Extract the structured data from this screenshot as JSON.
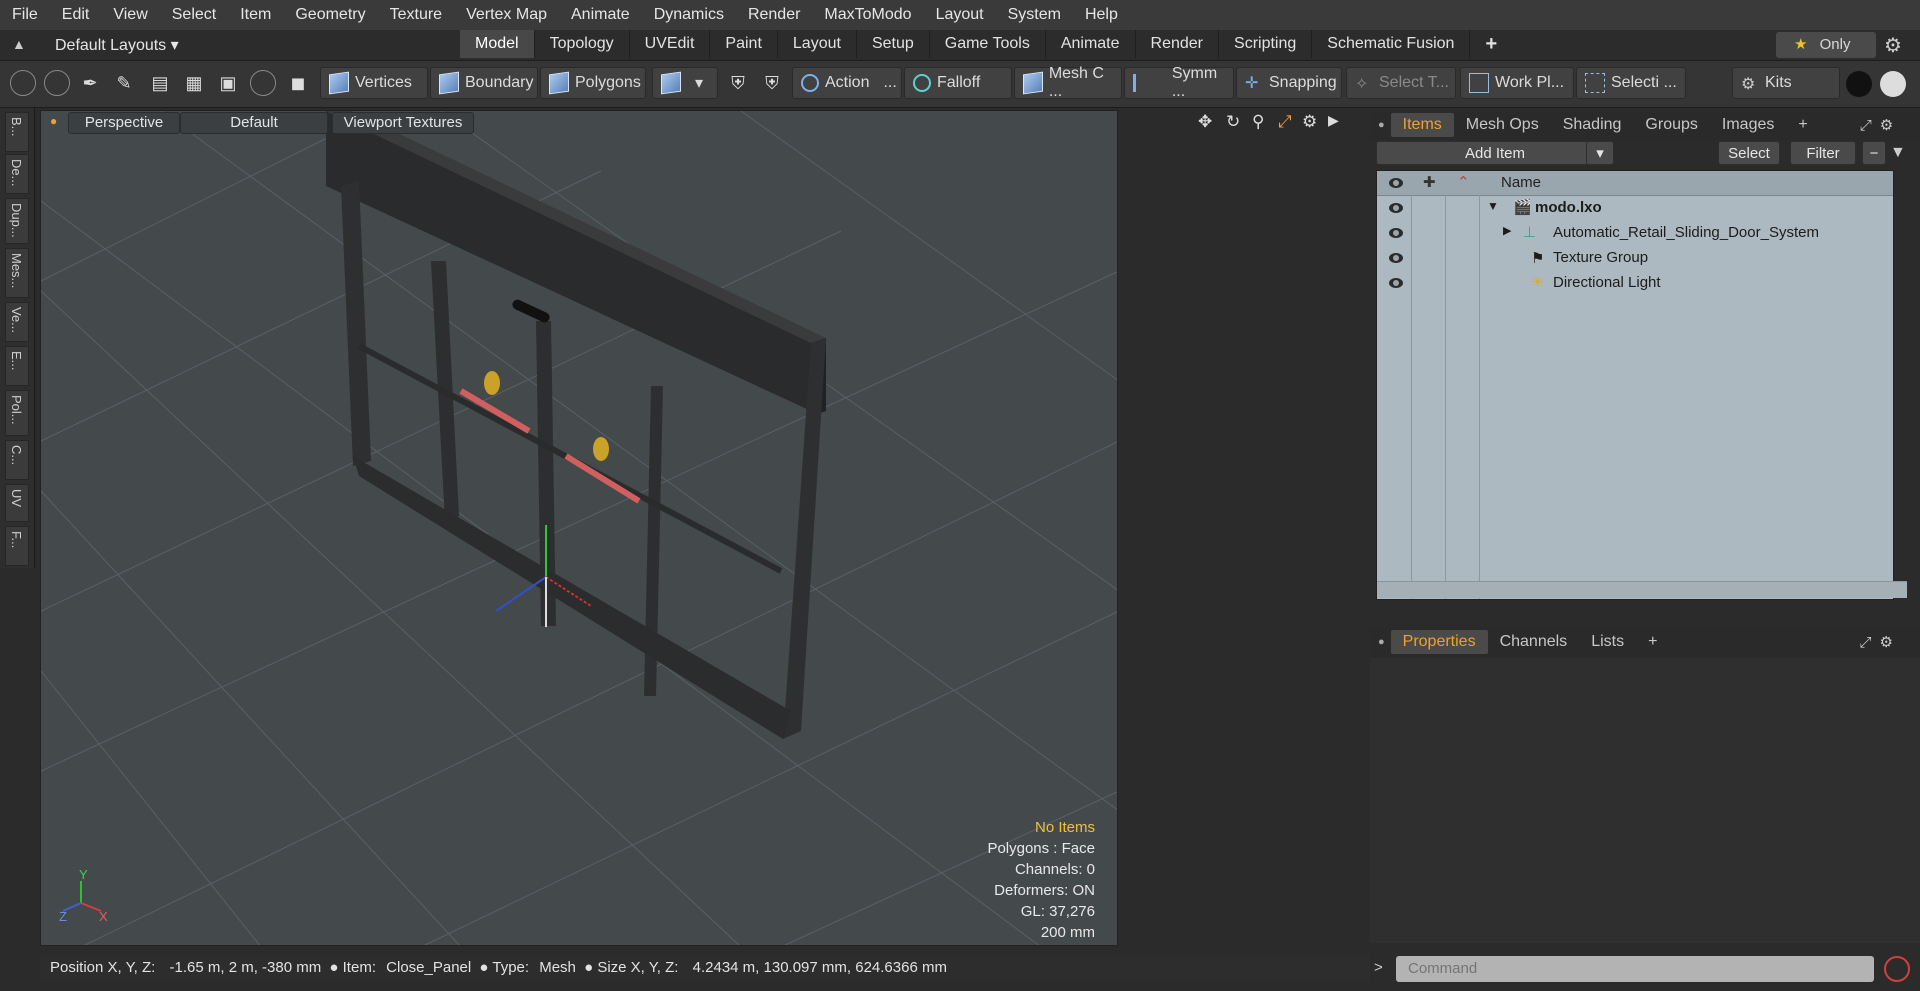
{
  "menu": [
    "File",
    "Edit",
    "View",
    "Select",
    "Item",
    "Geometry",
    "Texture",
    "Vertex Map",
    "Animate",
    "Dynamics",
    "Render",
    "MaxToModo",
    "Layout",
    "System",
    "Help"
  ],
  "layout": {
    "default_layouts": "Default Layouts",
    "tabs": [
      "Model",
      "Topology",
      "UVEdit",
      "Paint",
      "Layout",
      "Setup",
      "Game Tools",
      "Animate",
      "Render",
      "Scripting",
      "Schematic Fusion"
    ],
    "add": "+",
    "only": "Only"
  },
  "toolbar": {
    "vertices": "Vertices",
    "boundary": "Boundary",
    "polygons": "Polygons",
    "action": "Action",
    "action_more": "...",
    "falloff": "Falloff",
    "mesh": "Mesh C ...",
    "symm": "Symm ...",
    "snapping": "Snapping",
    "select_t": "Select T...",
    "workpl": "Work Pl...",
    "selecti": "Selecti ...",
    "kits": "Kits"
  },
  "sidebar_tabs": [
    "B...",
    "De...",
    "Dup...",
    "Mes...",
    "Ve...",
    "E...",
    "Pol...",
    "C...",
    "UV",
    "F..."
  ],
  "viewport": {
    "perspective": "Perspective",
    "default": "Default",
    "textures": "Viewport Textures",
    "stats": {
      "no_items": "No Items",
      "polygons": "Polygons : Face",
      "channels": "Channels: 0",
      "deformers": "Deformers: ON",
      "gl": "GL: 37,276",
      "size": "200 mm"
    },
    "axis": {
      "y": "Y",
      "z": "Z",
      "x": "X"
    }
  },
  "items_panel": {
    "tabs": [
      "Items",
      "Mesh Ops",
      "Shading",
      "Groups",
      "Images"
    ],
    "add_item": "Add Item",
    "select": "Select",
    "filter": "Filter",
    "name_header": "Name",
    "items": [
      {
        "name": "modo.lxo",
        "bold": true
      },
      {
        "name": "Automatic_Retail_Sliding_Door_System",
        "bold": false
      },
      {
        "name": "Texture Group",
        "bold": false
      },
      {
        "name": "Directional Light",
        "bold": false
      }
    ]
  },
  "properties_panel": {
    "tabs": [
      "Properties",
      "Channels",
      "Lists"
    ]
  },
  "status": {
    "position_label": "Position X, Y, Z:",
    "position": "-1.65 m, 2 m, -380 mm",
    "item_label": "Item:",
    "item": "Close_Panel",
    "type_label": "Type:",
    "type": "Mesh",
    "size_label": "Size X, Y, Z:",
    "size": "4.2434 m, 130.097 mm, 624.6366 mm"
  },
  "command_placeholder": "Command"
}
